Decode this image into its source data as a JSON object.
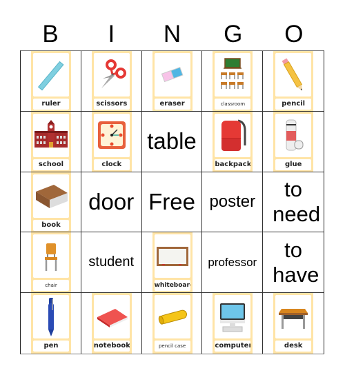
{
  "header": {
    "letters": [
      "B",
      "I",
      "N",
      "G",
      "O"
    ]
  },
  "cells": [
    {
      "type": "card",
      "label": "ruler",
      "icon": "ruler-icon"
    },
    {
      "type": "card",
      "label": "scissors",
      "icon": "scissors-icon"
    },
    {
      "type": "card",
      "label": "eraser",
      "icon": "eraser-icon"
    },
    {
      "type": "card",
      "label": "classroom",
      "icon": "classroom-icon",
      "small": true
    },
    {
      "type": "card",
      "label": "pencil",
      "icon": "pencil-icon"
    },
    {
      "type": "card",
      "label": "school",
      "icon": "school-icon"
    },
    {
      "type": "card",
      "label": "clock",
      "icon": "clock-icon"
    },
    {
      "type": "text",
      "text": "table"
    },
    {
      "type": "card",
      "label": "backpack",
      "icon": "backpack-icon"
    },
    {
      "type": "card",
      "label": "glue",
      "icon": "glue-icon"
    },
    {
      "type": "card",
      "label": "book",
      "icon": "book-icon"
    },
    {
      "type": "text",
      "text": "door"
    },
    {
      "type": "text",
      "text": "Free"
    },
    {
      "type": "text",
      "text": "poster"
    },
    {
      "type": "text",
      "text": "to need"
    },
    {
      "type": "card",
      "label": "chair",
      "icon": "chair-icon",
      "small": true
    },
    {
      "type": "text",
      "text": "student"
    },
    {
      "type": "card",
      "label": "whiteboard",
      "icon": "whiteboard-icon"
    },
    {
      "type": "text",
      "text": "professor"
    },
    {
      "type": "text",
      "text": "to have"
    },
    {
      "type": "card",
      "label": "pen",
      "icon": "pen-icon"
    },
    {
      "type": "card",
      "label": "notebook",
      "icon": "notebook-icon"
    },
    {
      "type": "card",
      "label": "pencil case",
      "icon": "pencil-case-icon",
      "small": true
    },
    {
      "type": "card",
      "label": "computer",
      "icon": "computer-icon"
    },
    {
      "type": "card",
      "label": "desk",
      "icon": "desk-icon"
    }
  ]
}
